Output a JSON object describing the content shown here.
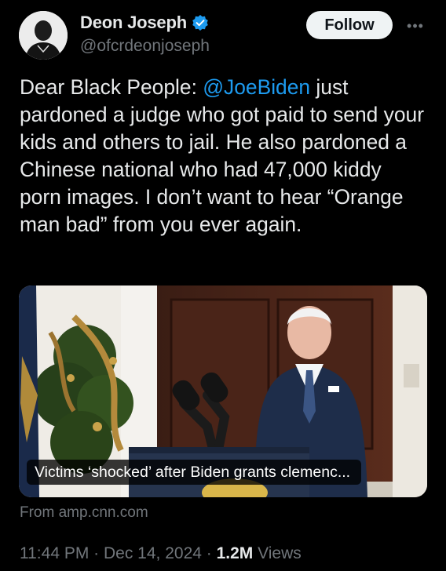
{
  "author": {
    "display_name": "Deon Joseph",
    "handle": "@ofcrdeonjoseph",
    "verified": true
  },
  "actions": {
    "follow_label": "Follow",
    "more_label": "•••"
  },
  "tweet": {
    "text_before_mention": "Dear Black People: ",
    "mention": "@JoeBiden",
    "text_after_mention": " just pardoned a judge who got paid to send your kids and others to jail.  He also pardoned a Chinese national who had 47,000 kiddy porn images.  I don’t want to hear “Orange man bad” from you ever again."
  },
  "link_card": {
    "title": "Victims ‘shocked’ after Biden grants clemenc...",
    "source": "From amp.cnn.com"
  },
  "meta": {
    "time": "11:44 PM",
    "separator": " · ",
    "date": "Dec 14, 2024",
    "views_count": "1.2M",
    "views_label": " Views"
  },
  "colors": {
    "background": "#000000",
    "text": "#e7e9ea",
    "secondary": "#71767b",
    "link": "#1d9bf0",
    "follow_bg": "#eff3f4"
  }
}
